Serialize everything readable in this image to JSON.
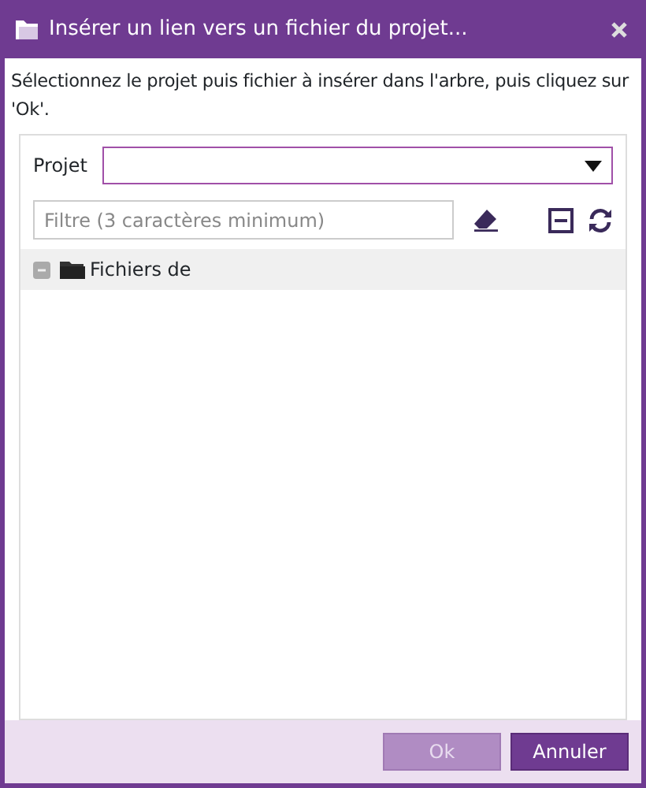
{
  "window": {
    "title": "Insérer un lien vers un fichier du projet..."
  },
  "instructions": "Sélectionnez le projet puis fichier à insérer dans l'arbre, puis cliquez sur 'Ok'.",
  "project": {
    "label": "Projet"
  },
  "filter": {
    "placeholder": "Filtre (3 caractères minimum)"
  },
  "tree": [
    {
      "label": "Fichiers de",
      "expanded": true
    }
  ],
  "buttons": [
    {
      "label": "Ok",
      "kind": "primary",
      "disabled": true
    },
    {
      "label": "Annuler",
      "kind": "primary",
      "disabled": false
    }
  ]
}
